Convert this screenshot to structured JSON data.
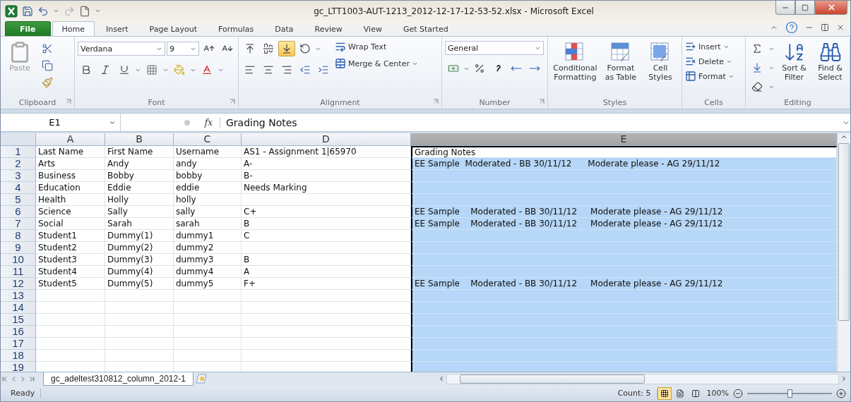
{
  "window": {
    "title": "gc_LTT1003-AUT-1213_2012-12-17-12-53-52.xlsx - Microsoft Excel"
  },
  "ribbon_tabs": [
    {
      "label": "File",
      "kind": "file",
      "selected": false
    },
    {
      "label": "Home",
      "kind": "tab",
      "selected": true
    },
    {
      "label": "Insert",
      "kind": "tab",
      "selected": false
    },
    {
      "label": "Page Layout",
      "kind": "tab",
      "selected": false
    },
    {
      "label": "Formulas",
      "kind": "tab",
      "selected": false
    },
    {
      "label": "Data",
      "kind": "tab",
      "selected": false
    },
    {
      "label": "Review",
      "kind": "tab",
      "selected": false
    },
    {
      "label": "View",
      "kind": "tab",
      "selected": false
    },
    {
      "label": "Get Started",
      "kind": "tab",
      "selected": false
    }
  ],
  "ribbon": {
    "clipboard": {
      "label": "Clipboard",
      "paste": {
        "label": "Paste",
        "disabled": true
      }
    },
    "font": {
      "label": "Font",
      "font_name": "Verdana",
      "font_size": "9"
    },
    "alignment": {
      "label": "Alignment",
      "wrap_text": "Wrap Text",
      "merge": "Merge & Center",
      "vertical_align": [
        {
          "selected": false
        },
        {
          "selected": false
        },
        {
          "selected": true
        }
      ]
    },
    "number": {
      "label": "Number",
      "format": "General"
    },
    "styles": {
      "label": "Styles",
      "buttons": [
        "Conditional Formatting",
        "Format as Table",
        "Cell Styles"
      ]
    },
    "cells": {
      "label": "Cells",
      "buttons": [
        "Insert",
        "Delete",
        "Format"
      ]
    },
    "editing": {
      "label": "Editing",
      "buttons": [
        "Sort & Filter",
        "Find & Select"
      ]
    }
  },
  "formula_bar": {
    "name_box": "E1",
    "function_symbol": "fx",
    "value": "Grading Notes"
  },
  "columns": [
    {
      "label": "A",
      "selected": false
    },
    {
      "label": "B",
      "selected": false
    },
    {
      "label": "C",
      "selected": false
    },
    {
      "label": "D",
      "selected": false
    },
    {
      "label": "E",
      "selected": true
    }
  ],
  "rows": [
    {
      "number": "1",
      "cells": [
        "Last Name",
        "First Name",
        "Username",
        "AS1 - Assignment 1|65970",
        "Grading Notes"
      ]
    },
    {
      "number": "2",
      "cells": [
        "Arts",
        "Andy",
        "andy",
        "A-",
        "EE Sample  Moderated - BB 30/11/12      Moderate please - AG 29/11/12"
      ]
    },
    {
      "number": "3",
      "cells": [
        "Business",
        "Bobby",
        "bobby",
        "B-"
      ]
    },
    {
      "number": "4",
      "cells": [
        "Education",
        "Eddie",
        "eddie",
        "Needs Marking"
      ]
    },
    {
      "number": "5",
      "cells": [
        "Health",
        "Holly",
        "holly"
      ]
    },
    {
      "number": "6",
      "cells": [
        "Science",
        "Sally",
        "sally",
        "C+",
        "EE Sample    Moderated - BB 30/11/12     Moderate please - AG 29/11/12"
      ]
    },
    {
      "number": "7",
      "cells": [
        "Social",
        "Sarah",
        "sarah",
        "B",
        "EE Sample    Moderated - BB 30/11/12     Moderate please - AG 29/11/12"
      ]
    },
    {
      "number": "8",
      "cells": [
        "Student1",
        "Dummy(1)",
        "dummy1",
        "C"
      ]
    },
    {
      "number": "9",
      "cells": [
        "Student2",
        "Dummy(2)",
        "dummy2"
      ]
    },
    {
      "number": "10",
      "cells": [
        "Student3",
        "Dummy(3)",
        "dummy3",
        "B"
      ]
    },
    {
      "number": "11",
      "cells": [
        "Student4",
        "Dummy(4)",
        "dummy4",
        "A"
      ]
    },
    {
      "number": "12",
      "cells": [
        "Student5",
        "Dummy(5)",
        "dummy5",
        "F+",
        "EE Sample    Moderated - BB 30/11/12     Moderate please - AG 29/11/12"
      ]
    },
    {
      "number": "13"
    },
    {
      "number": "14"
    },
    {
      "number": "15"
    },
    {
      "number": "16"
    },
    {
      "number": "17"
    },
    {
      "number": "18"
    },
    {
      "number": "19"
    }
  ],
  "sheet_tabs": [
    {
      "label": "gc_adeltest310812_column_2012-1",
      "selected": true
    }
  ],
  "status_bar": {
    "mode": "Ready",
    "count": "Count: 5",
    "zoom": "100%",
    "zoom_slider": {
      "level": 0.5
    }
  }
}
